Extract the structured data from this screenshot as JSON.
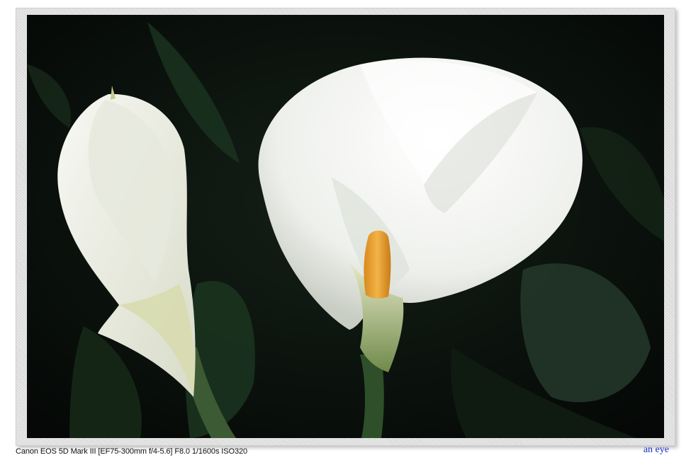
{
  "caption": {
    "exif": "Canon EOS 5D Mark III [EF75-300mm f/4-5.6] F8.0 1/1600s ISO320",
    "signature": "an eye"
  },
  "colors": {
    "background": "#0a0f0a",
    "petal": "#f4f5f2",
    "spadix": "#e8a23a",
    "leaf": "#1e3a22",
    "signature": "#1a33cc"
  },
  "photo": {
    "subject": [
      "calla-lily-bud",
      "calla-lily-open"
    ]
  }
}
